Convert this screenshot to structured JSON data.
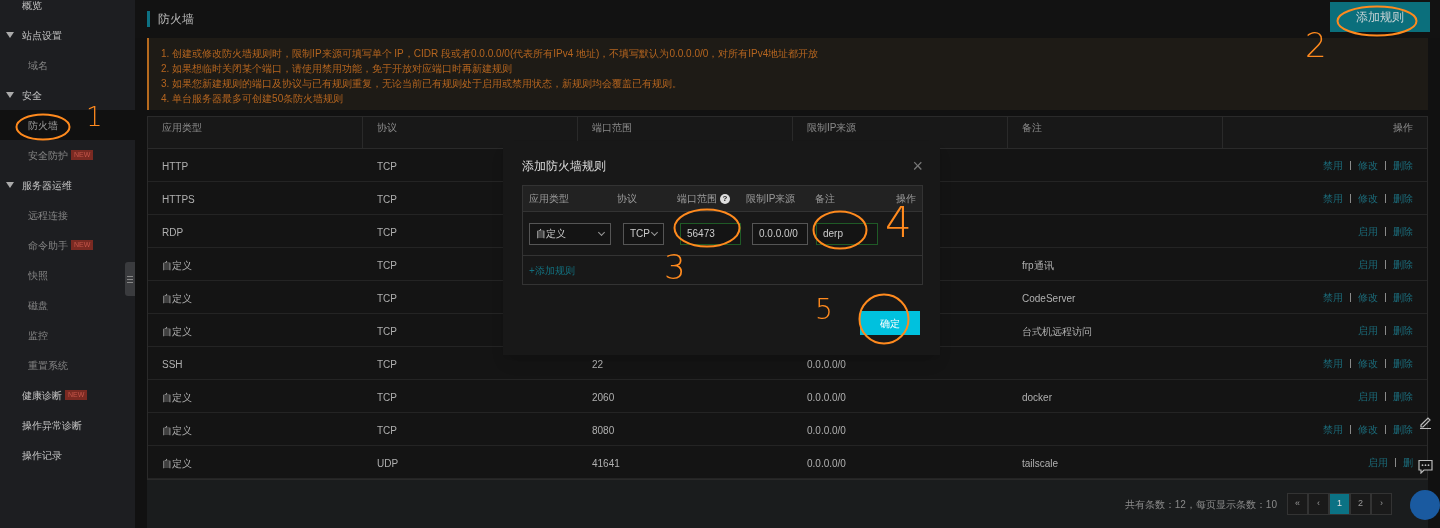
{
  "sidebar": {
    "items": [
      {
        "label": "概览",
        "selected": false
      },
      {
        "label": "站点设置",
        "selected": false,
        "expanded": true,
        "children": [
          {
            "label": "域名",
            "selected": false
          }
        ]
      },
      {
        "label": "安全",
        "selected": false,
        "expanded": true,
        "children": [
          {
            "label": "防火墙",
            "selected": true
          },
          {
            "label": "安全防护",
            "selected": false,
            "badge": "NEW"
          }
        ]
      },
      {
        "label": "服务器运维",
        "selected": false,
        "expanded": true,
        "children": [
          {
            "label": "远程连接",
            "selected": false
          },
          {
            "label": "命令助手",
            "selected": false,
            "badge": "NEW"
          },
          {
            "label": "快照",
            "selected": false
          },
          {
            "label": "磁盘",
            "selected": false
          },
          {
            "label": "监控",
            "selected": false
          },
          {
            "label": "重置系统",
            "selected": false
          }
        ]
      },
      {
        "label": "健康诊断",
        "selected": false,
        "badge": "NEW"
      },
      {
        "label": "操作异常诊断",
        "selected": false
      },
      {
        "label": "操作记录",
        "selected": false
      }
    ]
  },
  "page": {
    "title": "防火墙",
    "add_button": "添加规则",
    "notices": [
      "1. 创建或修改防火墙规则时，限制IP来源可填写单个 IP，CIDR 段或者0.0.0.0/0(代表所有IPv4 地址)，不填写默认为0.0.0.0/0，对所有IPv4地址都开放",
      "2. 如果想临时关闭某个端口，请使用禁用功能，免于开放对应端口时再新建规则",
      "3. 如果您新建规则的端口及协议与已有规则重复，无论当前已有规则处于启用或禁用状态，新规则均会覆盖已有规则。",
      "4. 单台服务器最多可创建50条防火墙规则"
    ]
  },
  "table": {
    "columns": [
      "应用类型",
      "协议",
      "端口范围",
      "限制IP来源",
      "备注",
      "操作"
    ],
    "rows": [
      {
        "type": "HTTP",
        "protocol": "TCP",
        "actions": [
          "禁用",
          "修改",
          "删除"
        ]
      },
      {
        "type": "HTTPS",
        "protocol": "TCP",
        "actions": [
          "禁用",
          "修改",
          "删除"
        ]
      },
      {
        "type": "RDP",
        "protocol": "TCP",
        "actions": [
          "启用",
          "删除"
        ]
      },
      {
        "type": "自定义",
        "protocol": "TCP",
        "note": "frp通讯",
        "actions": [
          "启用",
          "删除"
        ]
      },
      {
        "type": "自定义",
        "protocol": "TCP",
        "note": "CodeServer",
        "actions": [
          "禁用",
          "修改",
          "删除"
        ]
      },
      {
        "type": "自定义",
        "protocol": "TCP",
        "note": "台式机远程访问",
        "actions": [
          "启用",
          "删除"
        ]
      },
      {
        "type": "SSH",
        "protocol": "TCP",
        "port": "22",
        "ip": "0.0.0.0/0",
        "actions": [
          "禁用",
          "修改",
          "删除"
        ]
      },
      {
        "type": "自定义",
        "protocol": "TCP",
        "port": "2060",
        "ip": "0.0.0.0/0",
        "note": "docker",
        "actions": [
          "启用",
          "删除"
        ]
      },
      {
        "type": "自定义",
        "protocol": "TCP",
        "port": "8080",
        "ip": "0.0.0.0/0",
        "actions": [
          "禁用",
          "修改",
          "删除"
        ]
      },
      {
        "type": "自定义",
        "protocol": "UDP",
        "port": "41641",
        "ip": "0.0.0.0/0",
        "note": "tailscale",
        "actions": [
          "启用",
          "删"
        ]
      }
    ]
  },
  "pagination": {
    "summary": "共有条数：12，每页显示条数：10",
    "pages": [
      {
        "label": "«",
        "selected": false
      },
      {
        "label": "‹",
        "selected": false
      },
      {
        "label": "1",
        "selected": true
      },
      {
        "label": "2",
        "selected": false
      },
      {
        "label": "›",
        "selected": false
      }
    ]
  },
  "modal": {
    "title": "添加防火墙规则",
    "close": "×",
    "help": "?",
    "columns": [
      "应用类型",
      "协议",
      "端口范围",
      "限制IP来源",
      "备注",
      "操作"
    ],
    "fields": [
      {
        "kind": "select",
        "value": "自定义",
        "highlighted": false
      },
      {
        "kind": "select",
        "value": "TCP",
        "highlighted": false
      },
      {
        "kind": "input",
        "value": "56473",
        "highlighted": true
      },
      {
        "kind": "input",
        "value": "0.0.0.0/0",
        "highlighted": false
      },
      {
        "kind": "input",
        "value": "derp",
        "highlighted": true
      }
    ],
    "add_link": "+添加规则",
    "confirm": "确定"
  },
  "annotations": [
    {
      "number": "1"
    },
    {
      "number": "2"
    },
    {
      "number": "3"
    },
    {
      "number": "4"
    },
    {
      "number": "5"
    }
  ]
}
